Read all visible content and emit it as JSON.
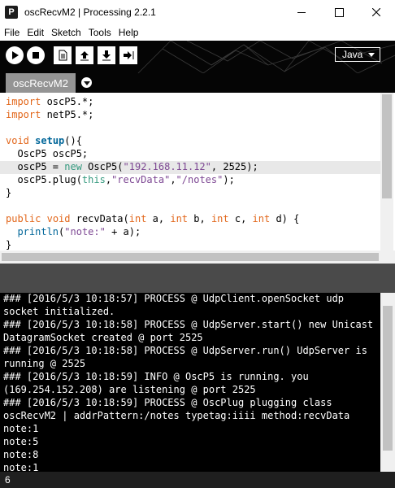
{
  "window": {
    "icon_letter": "P",
    "title": "oscRecvM2 | Processing 2.2.1"
  },
  "menu": [
    "File",
    "Edit",
    "Sketch",
    "Tools",
    "Help"
  ],
  "toolbar": {
    "buttons": [
      "run",
      "stop",
      "new",
      "open",
      "save",
      "export"
    ],
    "mode": "Java"
  },
  "tabs": {
    "active": "oscRecvM2"
  },
  "editor": {
    "lines": [
      "import oscP5.*;",
      "import netP5.*;",
      "",
      "void setup(){",
      "  OscP5 oscP5;",
      "  oscP5 = new OscP5(\"192.168.11.12\", 2525);",
      "  oscP5.plug(this,\"recvData\",\"/notes\");",
      "}",
      "",
      "public void recvData(int a, int b, int c, int d) {",
      "  println(\"note:\" + a);",
      "}"
    ],
    "highlighted_line": 6
  },
  "console": {
    "lines": [
      "### [2016/5/3 10:18:57] PROCESS @ UdpClient.openSocket udp",
      "socket initialized.",
      "### [2016/5/3 10:18:58] PROCESS @ UdpServer.start() new Unicast",
      "DatagramSocket created @ port 2525",
      "### [2016/5/3 10:18:58] PROCESS @ UdpServer.run() UdpServer is",
      "running @ 2525",
      "### [2016/5/3 10:18:59] INFO @ OscP5 is running. you",
      "(169.254.152.208) are listening @ port 2525",
      "### [2016/5/3 10:18:59] PROCESS @ OscPlug plugging class",
      "oscRecvM2 | addrPattern:/notes typetag:iiii method:recvData",
      "note:1",
      "note:5",
      "note:8",
      "note:1"
    ]
  },
  "footer": {
    "line_number": "6"
  },
  "colors": {
    "toolbar_bg": "#050505",
    "tab_active": "#949494",
    "console_bg": "#000000",
    "keyword_orange": "#e2661a",
    "keyword_teal": "#33997e",
    "function_blue": "#006699",
    "string_purple": "#7d4793"
  }
}
